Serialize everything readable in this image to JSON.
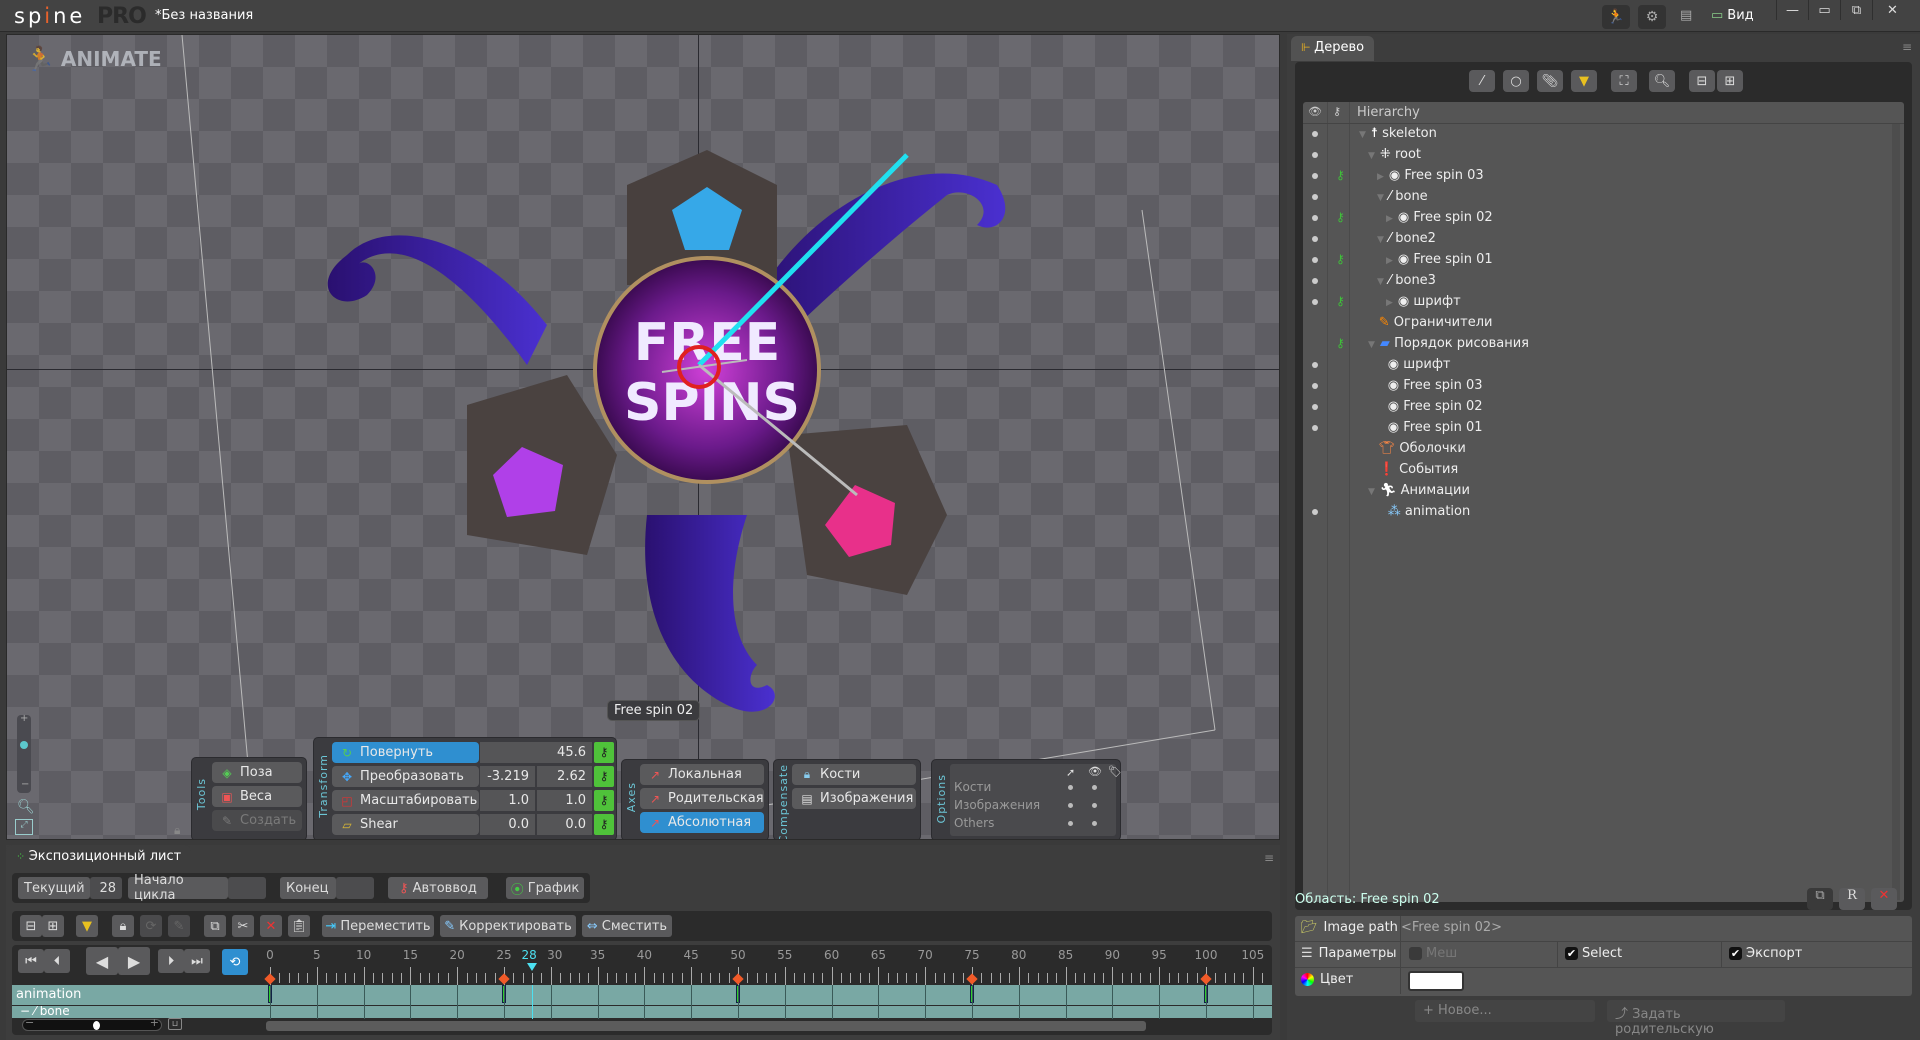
{
  "app": {
    "name_prefix": "sp",
    "name_i": "i",
    "name_suffix": "ne",
    "edition": "PRO",
    "document_title": "*Без названия"
  },
  "titlebar": {
    "animate_mode_icon": "running-man-icon",
    "settings_icon": "gear-play-icon",
    "layout_icon": "layers-icon",
    "view_label": "Вид",
    "minimize": "—",
    "maximize": "▭",
    "restore": "⧉",
    "close": "✕"
  },
  "viewport": {
    "mode_badge": "ANIMATE",
    "selection_tooltip": "Free spin 02",
    "graphic": {
      "title_line1": "FREE",
      "title_line2": "SPINS"
    },
    "tools": {
      "label": "Tools",
      "buttons": [
        {
          "label": "Поза",
          "icon": "pose-icon"
        },
        {
          "label": "Веса",
          "icon": "weights-icon"
        },
        {
          "label": "Создать",
          "icon": "create-icon",
          "disabled": true
        }
      ]
    },
    "transform": {
      "label": "Transform",
      "rows": [
        {
          "label": "Повернуть",
          "values": [
            "45.6"
          ],
          "selected": true
        },
        {
          "label": "Преобразовать",
          "values": [
            "-3.219",
            "2.62"
          ]
        },
        {
          "label": "Масштабировать",
          "values": [
            "1.0",
            "1.0"
          ]
        },
        {
          "label": "Shear",
          "values": [
            "0.0",
            "0.0"
          ]
        }
      ]
    },
    "axes": {
      "label": "Axes",
      "buttons": [
        {
          "label": "Локальная"
        },
        {
          "label": "Родительская"
        },
        {
          "label": "Абсолютная",
          "selected": true
        }
      ]
    },
    "compensate": {
      "label": "Compensate",
      "buttons": [
        {
          "label": "Кости"
        },
        {
          "label": "Изображения"
        }
      ]
    },
    "options": {
      "label": "Options",
      "rows": [
        "Кости",
        "Изображения",
        "Others"
      ]
    }
  },
  "tree_panel": {
    "tab_label": "Дерево",
    "header": "Hierarchy",
    "items": [
      {
        "label": "skeleton",
        "depth": 0,
        "icon": "skeleton-icon",
        "expanded": true,
        "eye": true,
        "key": false
      },
      {
        "label": "root",
        "depth": 1,
        "icon": "root-icon",
        "expanded": true,
        "eye": true,
        "key": false
      },
      {
        "label": "Free spin 03",
        "depth": 2,
        "icon": "slot-icon",
        "collapsed": true,
        "eye": true,
        "key": true
      },
      {
        "label": "bone",
        "depth": 2,
        "icon": "bone-icon",
        "expanded": true,
        "eye": true,
        "key": false
      },
      {
        "label": "Free spin 02",
        "depth": 3,
        "icon": "slot-icon",
        "collapsed": true,
        "eye": true,
        "key": true
      },
      {
        "label": "bone2",
        "depth": 2,
        "icon": "bone-icon",
        "expanded": true,
        "eye": true,
        "key": false
      },
      {
        "label": "Free spin 01",
        "depth": 3,
        "icon": "slot-icon",
        "collapsed": true,
        "eye": true,
        "key": true
      },
      {
        "label": "bone3",
        "depth": 2,
        "icon": "bone-icon",
        "expanded": true,
        "eye": true,
        "key": false
      },
      {
        "label": "шрифт",
        "depth": 3,
        "icon": "slot-icon",
        "collapsed": true,
        "eye": true,
        "key": true
      },
      {
        "label": "Ограничители",
        "depth": 1,
        "icon": "constraints-icon",
        "eye": false,
        "key": false
      },
      {
        "label": "Порядок рисования",
        "depth": 1,
        "icon": "draw-order-icon",
        "expanded": true,
        "eye": false,
        "key": true
      },
      {
        "label": "шрифт",
        "depth": 2,
        "icon": "slot-icon",
        "eye": true,
        "key": false
      },
      {
        "label": "Free spin 03",
        "depth": 2,
        "icon": "slot-icon",
        "eye": true,
        "key": false
      },
      {
        "label": "Free spin 02",
        "depth": 2,
        "icon": "slot-icon",
        "eye": true,
        "key": false
      },
      {
        "label": "Free spin 01",
        "depth": 2,
        "icon": "slot-icon",
        "eye": true,
        "key": false
      },
      {
        "label": "Оболочки",
        "depth": 1,
        "icon": "skins-icon",
        "eye": false,
        "key": false
      },
      {
        "label": "События",
        "depth": 1,
        "icon": "events-icon",
        "eye": false,
        "key": false
      },
      {
        "label": "Анимации",
        "depth": 1,
        "icon": "animations-icon",
        "expanded": true,
        "eye": false,
        "key": false
      },
      {
        "label": "animation",
        "depth": 2,
        "icon": "animation-icon",
        "eye": true,
        "key": false
      }
    ]
  },
  "properties": {
    "title": "Область: Free spin 02",
    "image_path_label": "Image path",
    "image_path_value": "<Free spin 02>",
    "params_label": "Параметры",
    "mesh_label": "Меш",
    "mesh_checked": false,
    "select_label": "Select",
    "select_checked": true,
    "export_label": "Экспорт",
    "export_checked": true,
    "color_label": "Цвет",
    "color_value": "#ffffff",
    "new_button": "Новое...",
    "set_parent_button": "Задать родительскую"
  },
  "dopesheet": {
    "tab_label": "Экспозиционный лист",
    "current_label": "Текущий",
    "current_value": "28",
    "loop_start_label": "Начало цикла",
    "loop_start_value": "",
    "end_label": "Конец",
    "end_value": "",
    "autokey_label": "Автоввод",
    "graph_label": "График",
    "move_label": "Переместить",
    "adjust_label": "Корректировать",
    "offset_label": "Сместить",
    "ruler_labels": [
      "0",
      "5",
      "10",
      "15",
      "20",
      "25",
      "30",
      "35",
      "40",
      "45",
      "50",
      "55",
      "60",
      "65",
      "70",
      "75",
      "80",
      "85",
      "90",
      "95",
      "100",
      "105"
    ],
    "current_frame": 28,
    "keyframes": [
      0,
      25,
      50,
      75,
      100
    ],
    "tracks": [
      {
        "label": "animation"
      },
      {
        "label": "bone"
      }
    ]
  }
}
